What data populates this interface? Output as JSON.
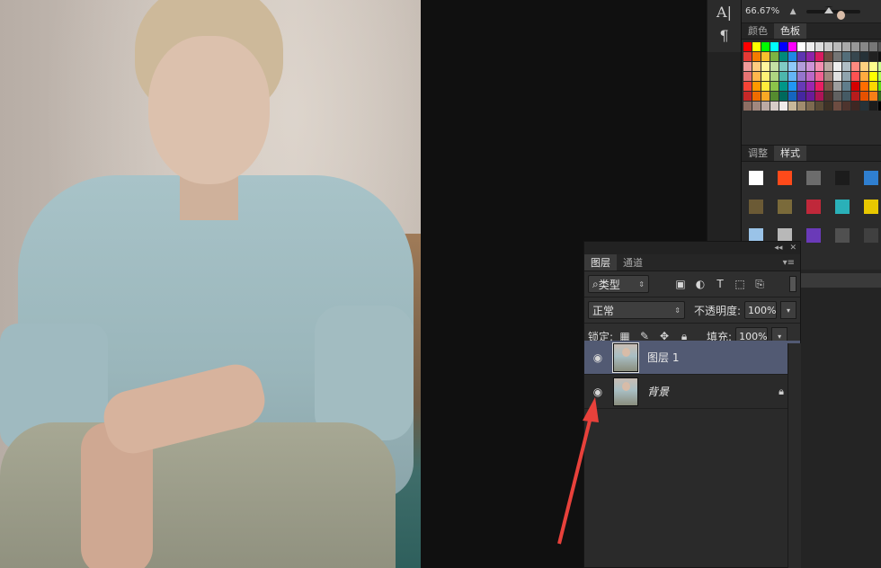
{
  "zoom": {
    "value": "66.67%"
  },
  "tools": {
    "text_icon": "A|",
    "paragraph_icon": "¶"
  },
  "color_panel": {
    "tabs": [
      "颜色",
      "色板"
    ],
    "active_tab": 1,
    "swatch_colors": [
      "#ff0000",
      "#ffff00",
      "#00ff00",
      "#00ffff",
      "#0000ff",
      "#ff00ff",
      "#ffffff",
      "#eeeeee",
      "#dddddd",
      "#cccccc",
      "#bbbbbb",
      "#aaaaaa",
      "#999999",
      "#888888",
      "#777777",
      "#555555",
      "#e53935",
      "#f57c00",
      "#fbc02d",
      "#7cb342",
      "#00897b",
      "#1e88e5",
      "#5e35b1",
      "#8e24aa",
      "#d81b60",
      "#6d4c41",
      "#757575",
      "#546e7a",
      "#37474f",
      "#263238",
      "#212121",
      "#111111",
      "#ef9a9a",
      "#ffcc80",
      "#fff59d",
      "#c5e1a5",
      "#80cbc4",
      "#90caf9",
      "#b39ddb",
      "#ce93d8",
      "#f48fb1",
      "#bcaaa4",
      "#eeeeee",
      "#b0bec5",
      "#ff8a80",
      "#ffd180",
      "#ffff8d",
      "#ccff90",
      "#e57373",
      "#ffb74d",
      "#fff176",
      "#aed581",
      "#4db6ac",
      "#64b5f6",
      "#9575cd",
      "#ba68c8",
      "#f06292",
      "#a1887f",
      "#e0e0e0",
      "#90a4ae",
      "#ff5252",
      "#ffab40",
      "#ffff00",
      "#b2ff59",
      "#f44336",
      "#ff9800",
      "#ffeb3b",
      "#8bc34a",
      "#009688",
      "#2196f3",
      "#673ab7",
      "#9c27b0",
      "#e91e63",
      "#795548",
      "#9e9e9e",
      "#607d8b",
      "#d50000",
      "#ff6d00",
      "#ffd600",
      "#64dd17",
      "#c62828",
      "#ef6c00",
      "#f9a825",
      "#558b2f",
      "#00695c",
      "#1565c0",
      "#4527a0",
      "#6a1b9a",
      "#ad1457",
      "#4e342e",
      "#616161",
      "#455a64",
      "#b71c1c",
      "#e65100",
      "#f57f17",
      "#33691e",
      "#8d6e63",
      "#a1887f",
      "#bcaaa4",
      "#d7ccc8",
      "#efebe9",
      "#c8b89a",
      "#a08c6e",
      "#7d6a50",
      "#5a4a36",
      "#3e3226",
      "#6d4c41",
      "#4e342e",
      "#3e2723",
      "#263238",
      "#1c1c1c",
      "#000000"
    ]
  },
  "styles_panel": {
    "tabs": [
      "调整",
      "样式"
    ],
    "active_tab": 1,
    "style_colors": [
      "#ffffff",
      "#ff4a1a",
      "#6c6c6c",
      "#1c1c1c",
      "#2f7fd0",
      "#6b5a35",
      "#7a6a3a",
      "#c0283a",
      "#2ab0b8",
      "#e8c800",
      "#9ac3e8",
      "#b8b8b8",
      "#6a3ab8",
      "#505050",
      "#404040"
    ]
  },
  "layers_panel": {
    "tabs": [
      "图层",
      "通道"
    ],
    "active_tab": 0,
    "filter_label": "类型",
    "blend_mode": "正常",
    "opacity_label": "不透明度:",
    "opacity_value": "100%",
    "lock_label": "锁定:",
    "fill_label": "填充:",
    "fill_value": "100%",
    "layers": [
      {
        "name": "图层 1",
        "visible": true,
        "selected": true,
        "locked": false
      },
      {
        "name": "背景",
        "visible": true,
        "selected": false,
        "locked": true
      }
    ]
  },
  "annotation": {
    "arrow_color": "#e8413b"
  }
}
